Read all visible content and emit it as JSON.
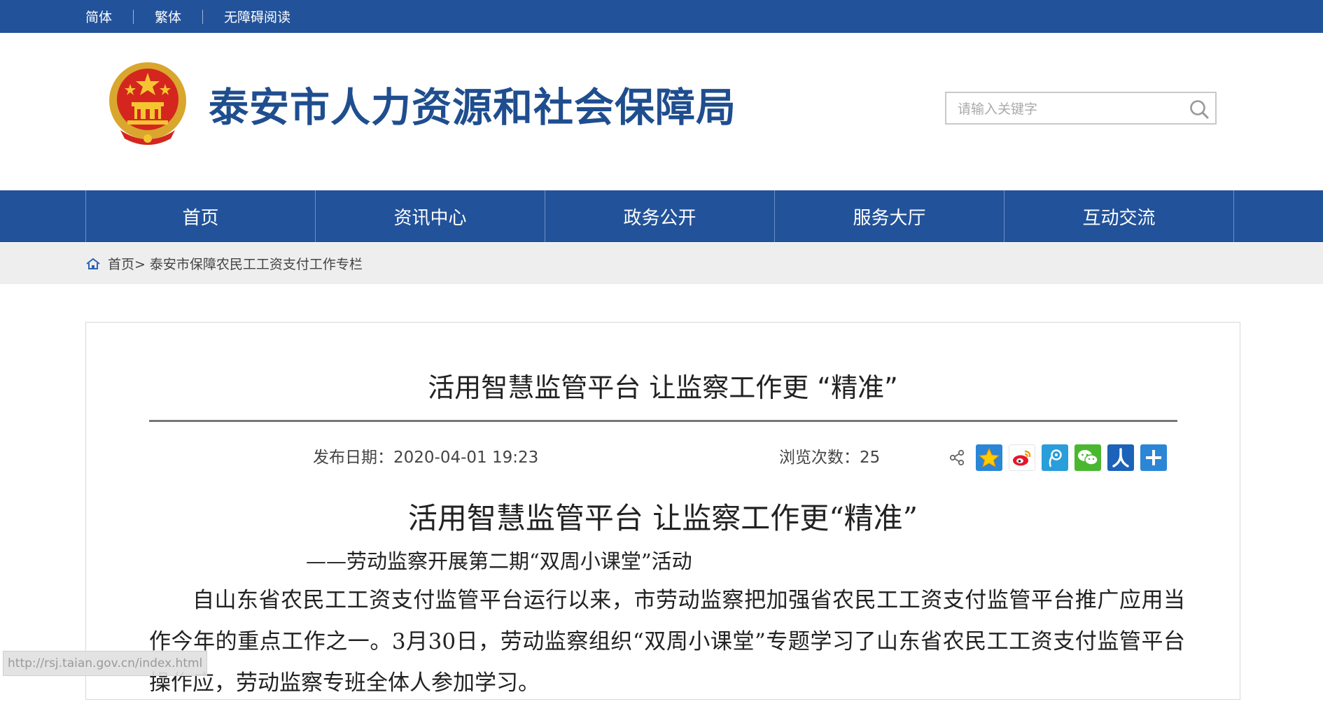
{
  "topbar": {
    "links": [
      "简体",
      "繁体",
      "无障碍阅读"
    ]
  },
  "header": {
    "site_title": "泰安市人力资源和社会保障局",
    "search_placeholder": "请输入关键字"
  },
  "nav": {
    "items": [
      "首页",
      "资讯中心",
      "政务公开",
      "服务大厅",
      "互动交流"
    ]
  },
  "breadcrumb": {
    "home": "首页>",
    "current": "泰安市保障农民工工资支付工作专栏"
  },
  "article": {
    "title": "活用智慧监管平台 让监察工作更 “精准”",
    "date_text": "发布日期：2020-04-01 19:23",
    "views_text": "浏览次数：25",
    "share_icons": [
      "qzone-icon",
      "weibo-icon",
      "tencent-weibo-icon",
      "wechat-icon",
      "renren-icon",
      "more-share-icon"
    ],
    "body_title": "活用智慧监管平台 让监察工作更“精准”",
    "body_subtitle": "——劳动监察开展第二期“双周小课堂”活动",
    "body_paragraph": "自山东省农民工工资支付监管平台运行以来，市劳动监察把加强省农民工工资支付监管平台推广应用当作今年的重点工作之一。3月30日，劳动监察组织“双周小课堂”专题学习了山东省农民工工资支付监管平台操作应，劳动监察专班全体人参加学习。"
  },
  "status_url": "http://rsj.taian.gov.cn/index.html",
  "colors": {
    "brand_blue": "#22529a",
    "title_blue": "#1f4e8f",
    "breadcrumb_bg": "#eeeeee"
  }
}
